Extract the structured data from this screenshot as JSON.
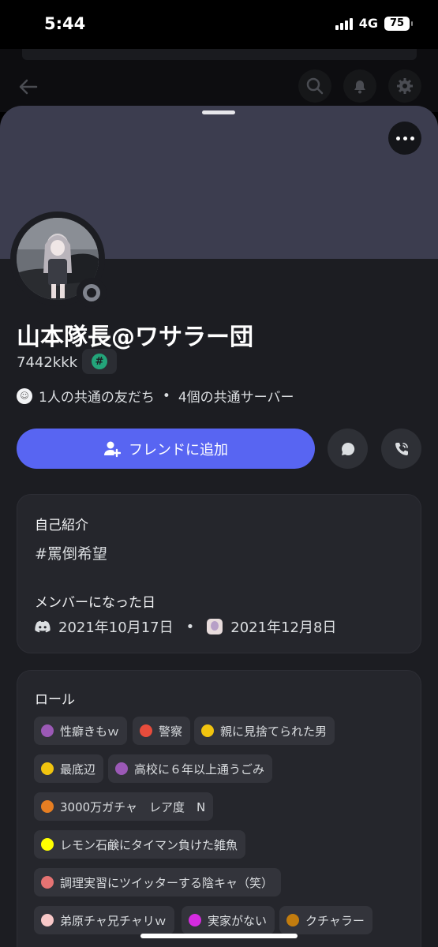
{
  "status_bar": {
    "time": "5:44",
    "network": "4G",
    "battery": "75"
  },
  "profile": {
    "display_name": "山本隊長@ワサラー団",
    "username": "7442kkk",
    "badge_symbol": "#",
    "mutual_friends": "1人の共通の友だち",
    "mutual_servers": "4個の共通サーバー",
    "separator": "•"
  },
  "actions": {
    "add_friend_label": "フレンドに追加"
  },
  "about": {
    "title": "自己紹介",
    "text": "#罵倒希望",
    "member_since_title": "メンバーになった日",
    "discord_date": "2021年10月17日",
    "separator": "•",
    "server_date": "2021年12月8日"
  },
  "roles_section": {
    "title": "ロール",
    "roles": [
      {
        "label": "性癖きもｗ",
        "color": "#9b59b6"
      },
      {
        "label": "警察",
        "color": "#e74c3c"
      },
      {
        "label": "親に見捨てられた男",
        "color": "#f1c40f"
      },
      {
        "label": "最底辺",
        "color": "#f1c40f"
      },
      {
        "label": "高校に６年以上通うごみ",
        "color": "#9b59b6"
      },
      {
        "label": "3000万ガチャ　レア度　N",
        "color": "#e67e22"
      },
      {
        "label": "レモン石鹸にタイマン負けた雑魚",
        "color": "#ffff00"
      },
      {
        "label": "調理実習にツイッターする陰キャ（笑）",
        "color": "#e57373"
      },
      {
        "label": "弟原チャ兄チャリｗ",
        "color": "#f8c8c8"
      },
      {
        "label": "実家がない",
        "color": "#d52be0"
      },
      {
        "label": "クチャラー",
        "color": "#c27c0e"
      }
    ]
  },
  "colors": {
    "accent": "#5865f2",
    "banner": "#3c3d4f",
    "sheet": "#1c1d22",
    "card": "#25262c"
  }
}
